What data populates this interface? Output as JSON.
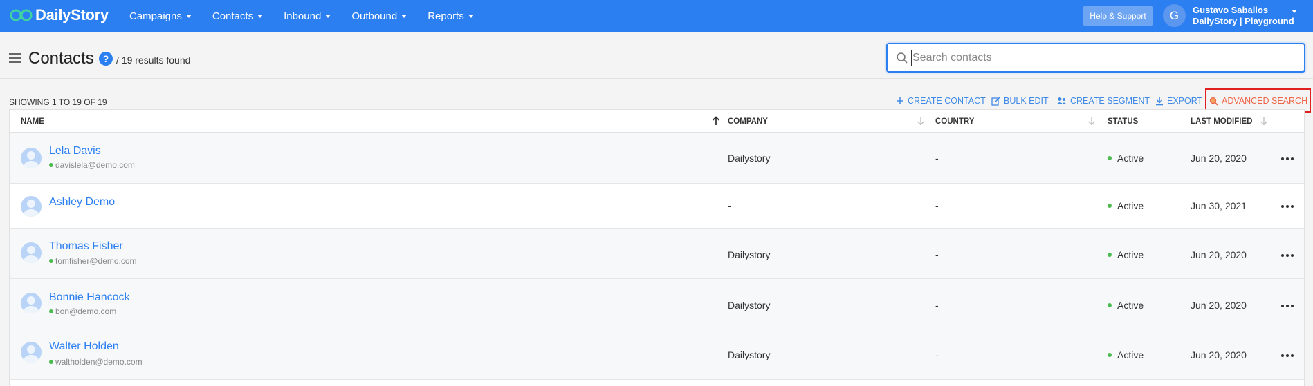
{
  "brand": {
    "name": "DailyStory",
    "accent": "#2b7ff0"
  },
  "nav": {
    "items": [
      {
        "label": "Campaigns"
      },
      {
        "label": "Contacts"
      },
      {
        "label": "Inbound"
      },
      {
        "label": "Outbound"
      },
      {
        "label": "Reports"
      }
    ],
    "help_label": "Help & Support",
    "user_initial": "G",
    "user_name": "Gustavo Saballos",
    "user_org": "DailyStory | Playground"
  },
  "header": {
    "title": "Contacts",
    "help_icon": "?",
    "results": "/ 19 results found",
    "search_placeholder": "Search contacts"
  },
  "toolbar": {
    "showing": "SHOWING 1 TO 19 OF 19",
    "create_contact": "CREATE CONTACT",
    "bulk_edit": "BULK EDIT",
    "create_segment": "CREATE SEGMENT",
    "export": "EXPORT",
    "advanced_search": "ADVANCED SEARCH"
  },
  "table": {
    "columns": {
      "name": "NAME",
      "company": "COMPANY",
      "country": "COUNTRY",
      "status": "STATUS",
      "last_modified": "LAST MODIFIED"
    },
    "rows": [
      {
        "name": "Lela Davis",
        "email": "davislela@demo.com",
        "company": "Dailystory",
        "country": "-",
        "status": "Active",
        "modified": "Jun 20, 2020"
      },
      {
        "name": "Ashley Demo",
        "email": "",
        "company": "-",
        "country": "-",
        "status": "Active",
        "modified": "Jun 30, 2021"
      },
      {
        "name": "Thomas Fisher",
        "email": "tomfisher@demo.com",
        "company": "Dailystory",
        "country": "-",
        "status": "Active",
        "modified": "Jun 20, 2020"
      },
      {
        "name": "Bonnie Hancock",
        "email": "bon@demo.com",
        "company": "Dailystory",
        "country": "-",
        "status": "Active",
        "modified": "Jun 20, 2020"
      },
      {
        "name": "Walter Holden",
        "email": "waltholden@demo.com",
        "company": "Dailystory",
        "country": "-",
        "status": "Active",
        "modified": "Jun 20, 2020"
      }
    ]
  },
  "colors": {
    "active": "#4cbb50",
    "advanced": "#ef6548",
    "highlight": "#e02020"
  }
}
